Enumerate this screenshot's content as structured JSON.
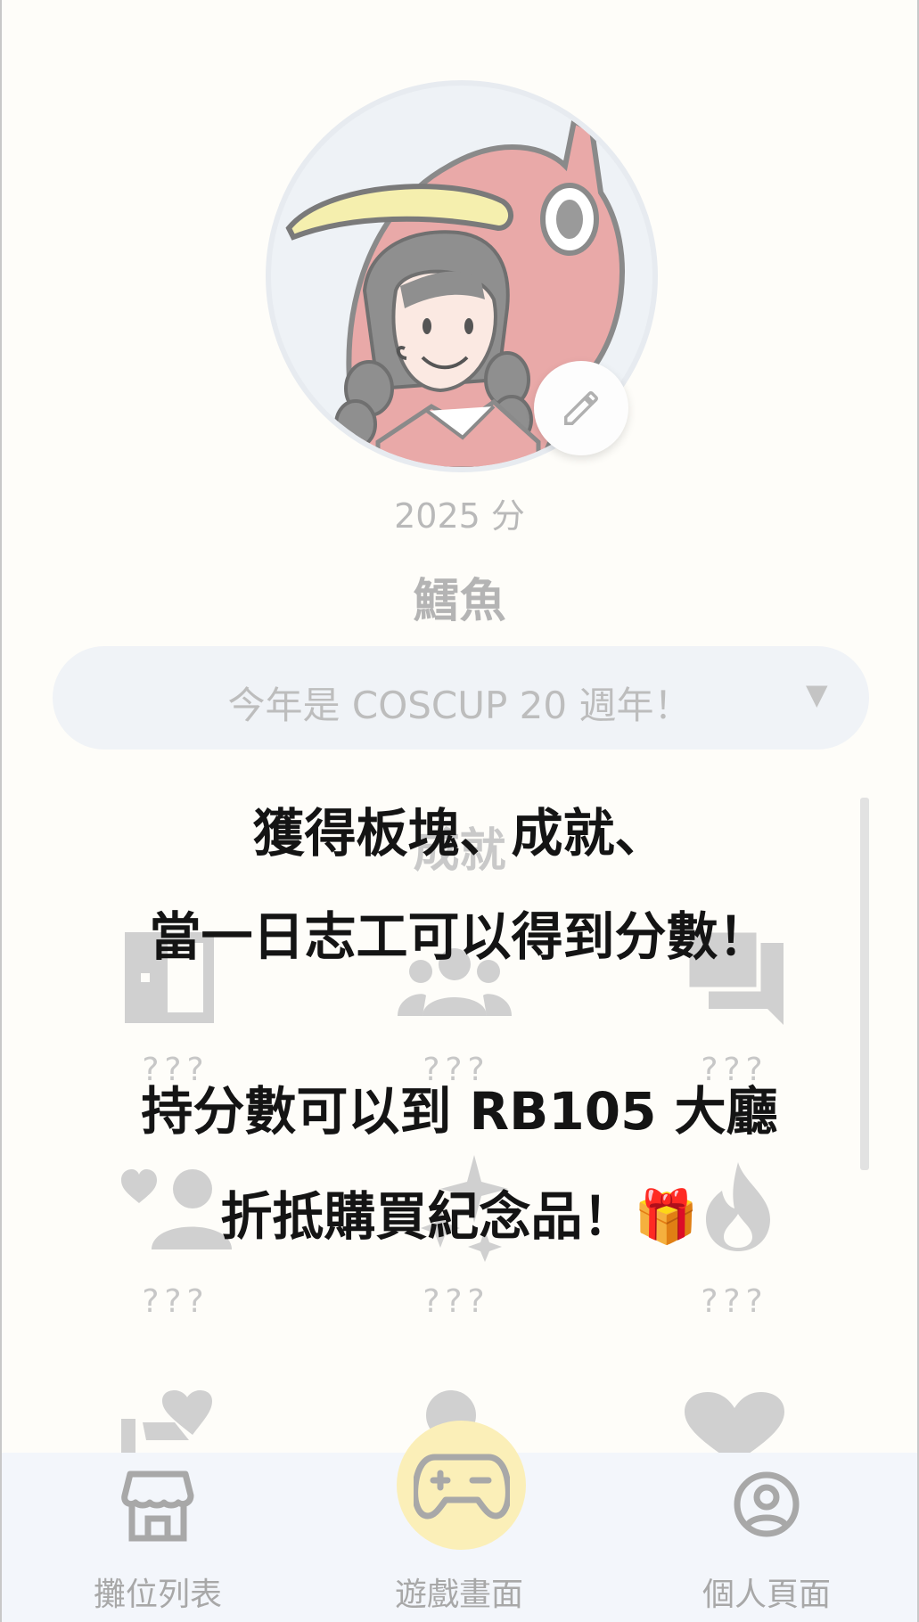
{
  "profile": {
    "score": "2025 分",
    "name": "鱈魚"
  },
  "select": {
    "value": "今年是 COSCUP 20 週年！",
    "arrow": "▼"
  },
  "achievements": {
    "title": "成就",
    "items": [
      {
        "icon": "door-icon",
        "label": "???"
      },
      {
        "icon": "group-icon",
        "label": "???"
      },
      {
        "icon": "chat-icon",
        "label": "???"
      },
      {
        "icon": "person-heart-icon",
        "label": "???"
      },
      {
        "icon": "sparkles-icon",
        "label": "???"
      },
      {
        "icon": "fire-icon",
        "label": "???"
      },
      {
        "icon": "hand-heart-icon",
        "label": ""
      },
      {
        "icon": "person-icon",
        "label": ""
      },
      {
        "icon": "heart-icon",
        "label": ""
      }
    ]
  },
  "overlay": {
    "line1": "獲得板塊、成就、",
    "line2": "當一日志工可以得到分數！",
    "line3": "持分數可以到 RB105 大廳",
    "line4": "折抵購買紀念品！🎁"
  },
  "nav": {
    "booths": "攤位列表",
    "game": "遊戲畫面",
    "profile": "個人頁面"
  },
  "colors": {
    "background": "#fefdf9",
    "nav_background": "#f3f6fb",
    "game_button": "#fbefb8",
    "avatar_hood": "#e9a9a8",
    "avatar_hat": "#f5efae"
  }
}
